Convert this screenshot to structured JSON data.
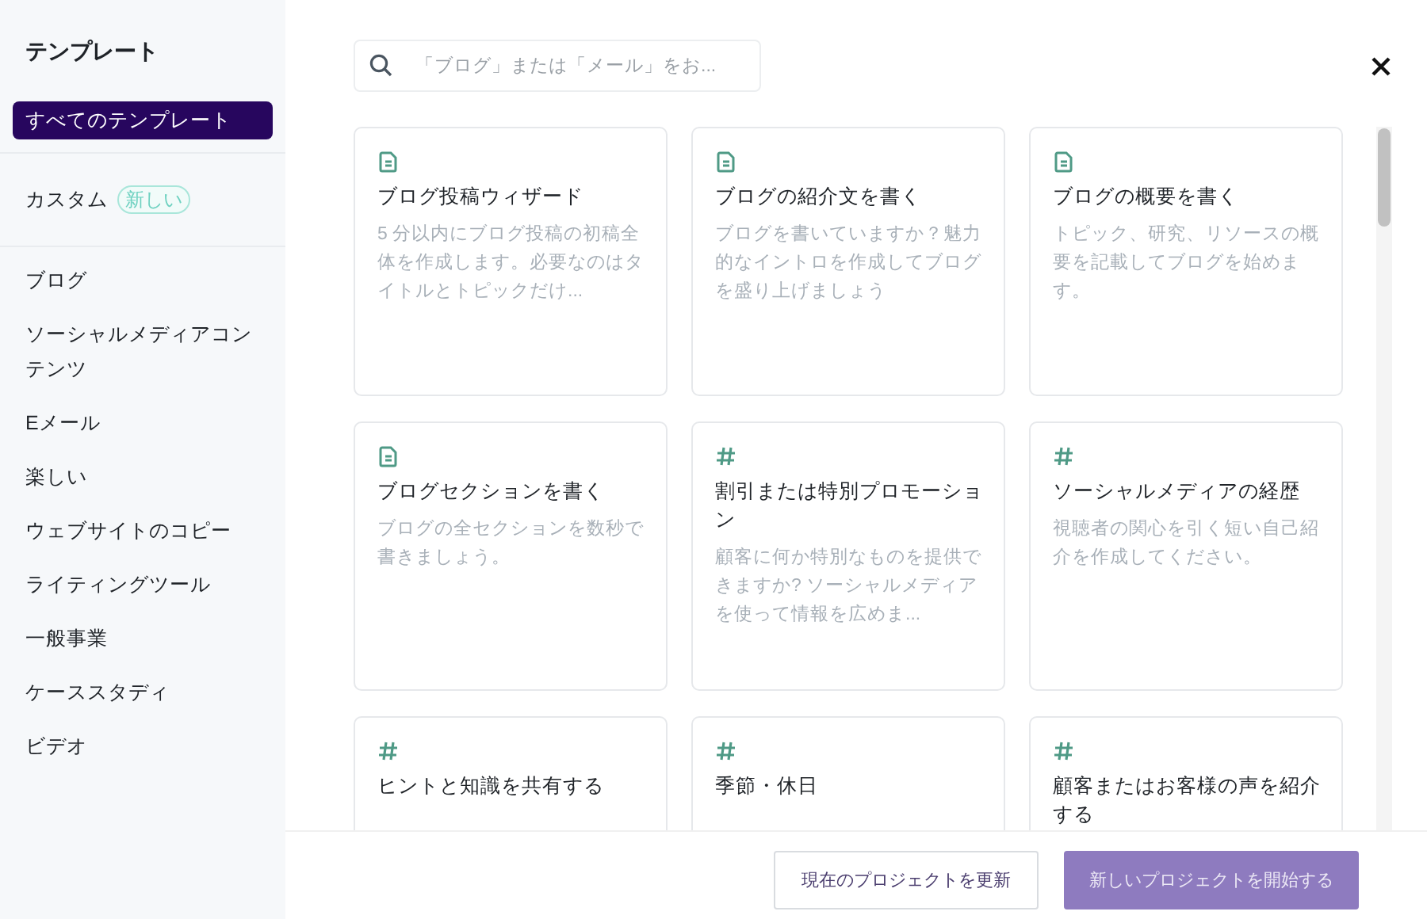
{
  "sidebar": {
    "title": "テンプレート",
    "top_items": [
      {
        "label": "すべてのテンプレート",
        "selected": true
      }
    ],
    "custom_items": [
      {
        "label": "カスタム",
        "badge": "新しい",
        "selected": false
      }
    ],
    "categories": [
      {
        "label": "ブログ",
        "selected": false
      },
      {
        "label": "ソーシャルメディアコンテンツ",
        "selected": false
      },
      {
        "label": "Eメール",
        "selected": false
      },
      {
        "label": "楽しい",
        "selected": false
      },
      {
        "label": "ウェブサイトのコピー",
        "selected": false
      },
      {
        "label": "ライティングツール",
        "selected": false
      },
      {
        "label": "一般事業",
        "selected": false
      },
      {
        "label": "ケーススタディ",
        "selected": false
      },
      {
        "label": "ビデオ",
        "selected": false
      }
    ]
  },
  "search": {
    "placeholder": "「ブログ」または「メール」をお..."
  },
  "cards": [
    {
      "kind": "document",
      "title": "ブログ投稿ウィザード",
      "description": "5 分以内にブログ投稿の初稿全体を作成します。必要なのはタイトルとトピックだけ..."
    },
    {
      "kind": "document",
      "title": "ブログの紹介文を書く",
      "description": "ブログを書いていますか？魅力的なイントロを作成してブログを盛り上げましょう"
    },
    {
      "kind": "document",
      "title": "ブログの概要を書く",
      "description": "トピック、研究、リソースの概要を記載してブログを始めます。"
    },
    {
      "kind": "document",
      "title": "ブログセクションを書く",
      "description": "ブログの全セクションを数秒で書きましょう。"
    },
    {
      "kind": "hashtag",
      "title": "割引または特別プロモーション",
      "description": "顧客に何か特別なものを提供できますか? ソーシャルメディアを使って情報を広めま..."
    },
    {
      "kind": "hashtag",
      "title": "ソーシャルメディアの経歴",
      "description": "視聴者の関心を引く短い自己紹介を作成してください。"
    },
    {
      "kind": "hashtag",
      "title": "ヒントと知識を共有する"
    },
    {
      "kind": "hashtag",
      "title": "季節・休日"
    },
    {
      "kind": "hashtag",
      "title": "顧客またはお客様の声を紹介する"
    }
  ],
  "buttons": [
    {
      "label": "現在のプロジェクトを更新",
      "kind": "secondary",
      "disabled": false
    },
    {
      "label": "新しいプロジェクトを開始する",
      "kind": "primary",
      "disabled": true
    }
  ]
}
